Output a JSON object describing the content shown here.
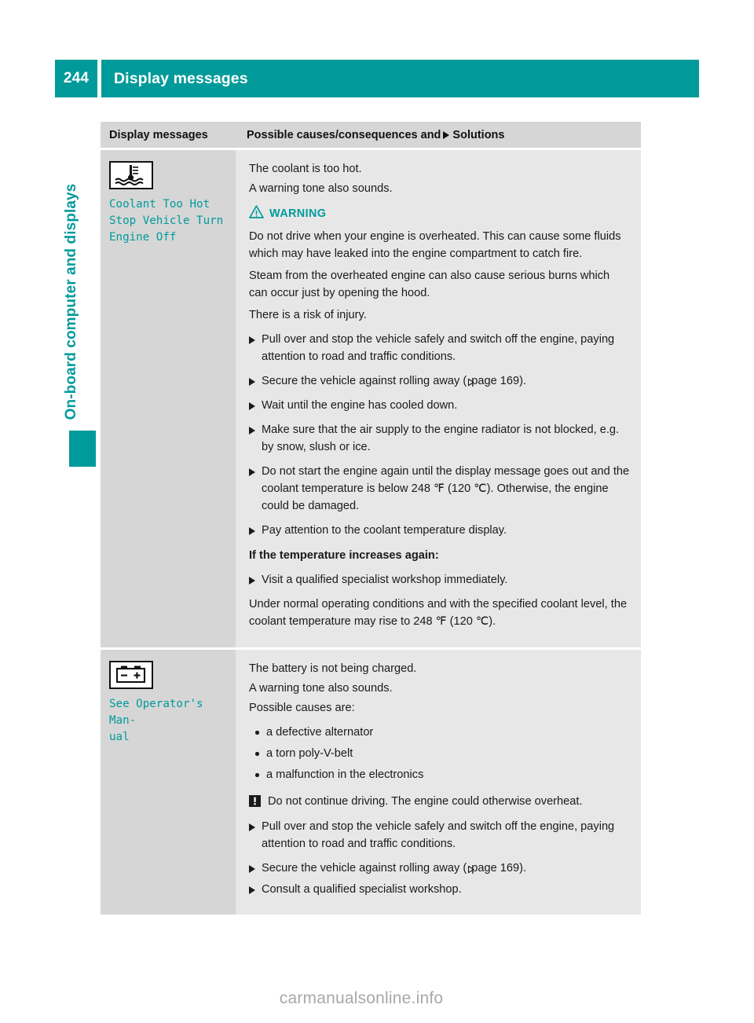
{
  "header": {
    "page_number": "244",
    "title": "Display messages"
  },
  "side_tab": {
    "chapter_label": "On-board computer and displays"
  },
  "table": {
    "headers": {
      "left": "Display messages",
      "right_before_arrow": "Possible causes/consequences and",
      "right_after_arrow": "Solutions"
    },
    "rows": [
      {
        "icon_name": "coolant-temperature-warning-icon",
        "message_code": "Coolant Too Hot\nStop Vehicle Turn\nEngine Off",
        "intro": [
          "The coolant is too hot.",
          "A warning tone also sounds."
        ],
        "warning_label": "WARNING",
        "warning_paragraphs": [
          "Do not drive when your engine is overheated. This can cause some fluids which may have leaked into the engine compartment to catch fire.",
          "Steam from the overheated engine can also cause serious burns which can occur just by opening the hood.",
          "There is a risk of injury."
        ],
        "steps": [
          "Pull over and stop the vehicle safely and switch off the engine, paying attention to road and traffic conditions.",
          "Wait until the engine has cooled down.",
          "Make sure that the air supply to the engine radiator is not blocked, e.g. by snow, slush or ice.",
          "Do not start the engine again until the display message goes out and the coolant temperature is below 248 ℉ (120 ℃). Otherwise, the engine could be damaged.",
          "Pay attention to the coolant temperature display."
        ],
        "step_secure_prefix": "Secure the vehicle against rolling away (",
        "step_secure_ref": "page 169",
        "step_secure_suffix": ").",
        "subheading": "If the temperature increases again:",
        "step_visit": "Visit a qualified specialist workshop immediately.",
        "closing": "Under normal operating conditions and with the specified coolant level, the coolant temperature may rise to 248 ℉ (120 ℃)."
      },
      {
        "icon_name": "battery-charge-warning-icon",
        "message_code": "See Operator's Man-\nual",
        "intro": [
          "The battery is not being charged.",
          "A warning tone also sounds.",
          "Possible causes are:"
        ],
        "causes": [
          "a defective alternator",
          "a torn poly-V-belt",
          "a malfunction in the electronics"
        ],
        "caution": "Do not continue driving. The engine could otherwise overheat.",
        "step_pull_over": "Pull over and stop the vehicle safely and switch off the engine, paying attention to road and traffic conditions.",
        "step_secure_prefix": "Secure the vehicle against rolling away (",
        "step_secure_ref": "page 169",
        "step_secure_suffix": ").",
        "step_consult": "Consult a qualified specialist workshop."
      }
    ]
  },
  "footer": {
    "watermark": "carmanualsonline.info"
  },
  "colors": {
    "accent_teal": "#009a9a",
    "header_row_gray": "#d6d6d6",
    "body_row_gray": "#e7e7e7",
    "text_dark": "#1a1a1a"
  }
}
